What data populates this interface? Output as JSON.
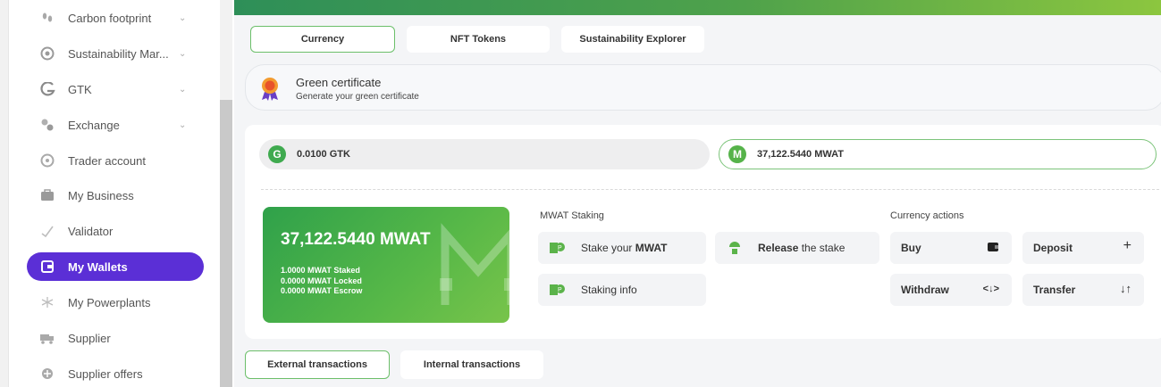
{
  "sidebar": {
    "items": [
      {
        "label": "Carbon footprint",
        "icon": "footprint-icon",
        "chevron": true,
        "active": false
      },
      {
        "label": "Sustainability Mar...",
        "icon": "target-icon",
        "chevron": true,
        "active": false
      },
      {
        "label": "GTK",
        "icon": "gtk-logo-icon",
        "chevron": true,
        "active": false
      },
      {
        "label": "Exchange",
        "icon": "exchange-icon",
        "chevron": true,
        "active": false
      },
      {
        "label": "Trader account",
        "icon": "trader-icon",
        "chevron": false,
        "active": false
      },
      {
        "label": "My Business",
        "icon": "briefcase-icon",
        "chevron": false,
        "active": false
      },
      {
        "label": "Validator",
        "icon": "check-icon",
        "chevron": false,
        "active": false
      },
      {
        "label": "My Wallets",
        "icon": "wallet-icon",
        "chevron": false,
        "active": true
      },
      {
        "label": "My Powerplants",
        "icon": "powerplant-icon",
        "chevron": false,
        "active": false
      },
      {
        "label": "Supplier",
        "icon": "truck-icon",
        "chevron": false,
        "active": false
      },
      {
        "label": "Supplier offers",
        "icon": "offers-icon",
        "chevron": false,
        "active": false
      }
    ]
  },
  "tabs": [
    "Currency",
    "NFT Tokens",
    "Sustainability Explorer"
  ],
  "certificate": {
    "title": "Green certificate",
    "subtitle": "Generate your green certificate"
  },
  "balances": {
    "gtk": "0.0100 GTK",
    "mwat": "37,122.5440 MWAT"
  },
  "card": {
    "amount": "37,122.5440 MWAT",
    "staked": "1.0000 MWAT Staked",
    "locked": "0.0000 MWAT Locked",
    "escrow": "0.0000 MWAT Escrow"
  },
  "staking": {
    "title": "MWAT Staking",
    "stake_prefix": "Stake your ",
    "stake_bold": "MWAT",
    "release_bold": "Release",
    "release_suffix": " the stake",
    "info": "Staking info"
  },
  "currency_actions": {
    "title": "Currency actions",
    "buy": "Buy",
    "deposit": "Deposit",
    "withdraw": "Withdraw",
    "transfer": "Transfer"
  },
  "bottom_tabs": [
    "External transactions",
    "Internal transactions"
  ],
  "colors": {
    "accent_purple": "#5b2fd6",
    "brand_green": "#4fa24b"
  }
}
